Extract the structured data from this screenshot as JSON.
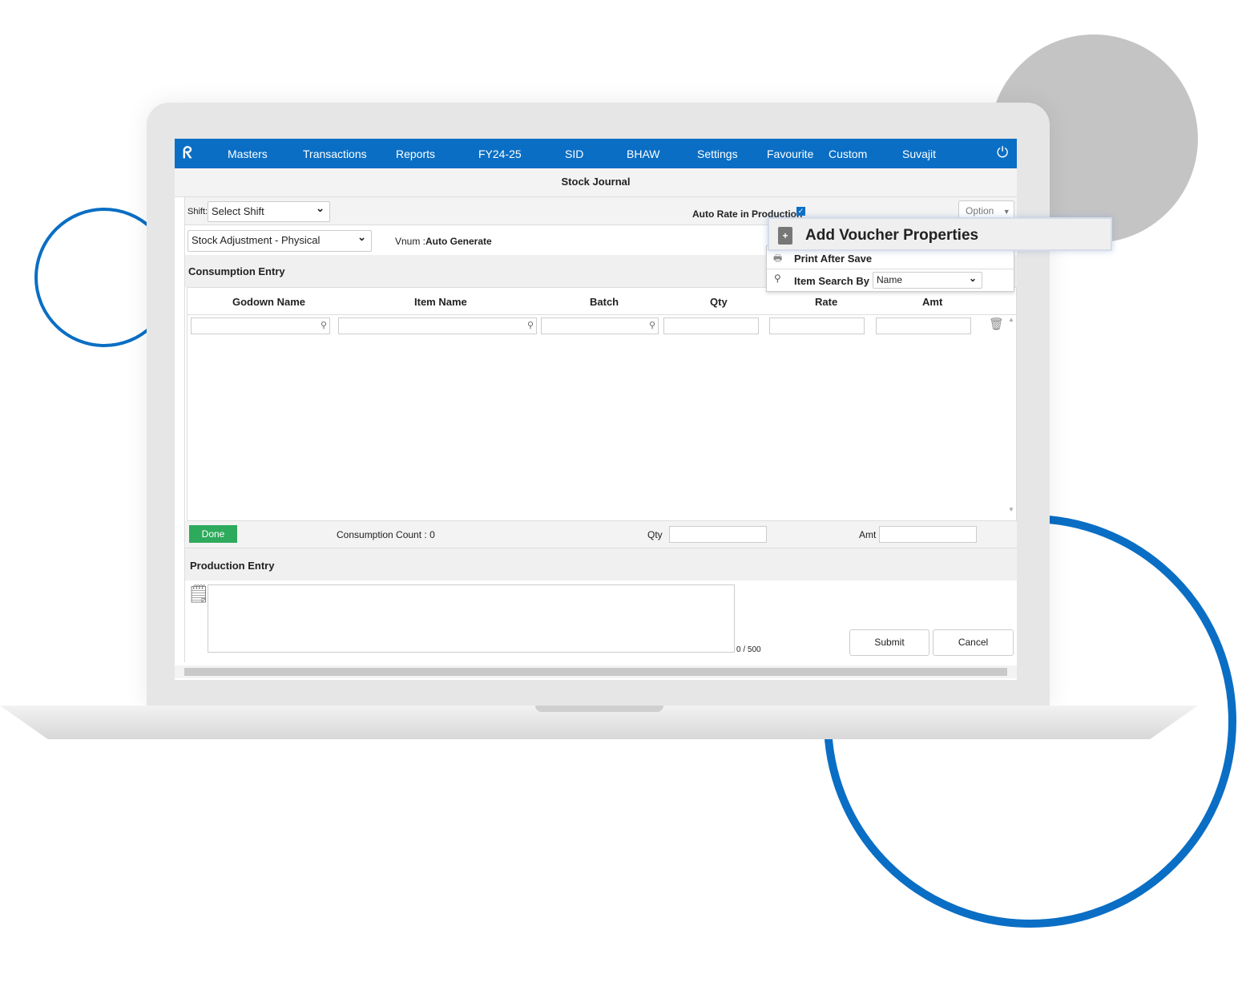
{
  "nav": {
    "items": [
      "Masters",
      "Transactions",
      "Reports",
      "FY24-25",
      "SID",
      "BHAW",
      "Settings",
      "Favourite",
      "Custom",
      "Suvajit"
    ]
  },
  "page_title": "Stock Journal",
  "shift": {
    "label": "Shift:",
    "value": "Select Shift"
  },
  "voucher_type": {
    "value": "Stock Adjustment - Physical"
  },
  "vnum": {
    "label": "Vnum :",
    "value": "Auto Generate"
  },
  "auto_rate": {
    "label": "Auto Rate in Production",
    "checked": true
  },
  "option": {
    "label": "Option"
  },
  "menu": {
    "add": "Add Voucher Properties",
    "print": "Print After Save",
    "search_label": "Item Search By :",
    "search_value": "Name"
  },
  "consumption": {
    "title": "Consumption Entry",
    "columns": [
      "Godown Name",
      "Item Name",
      "Batch",
      "Qty",
      "Rate",
      "Amt"
    ],
    "done": "Done",
    "count": "Consumption Count : 0",
    "qty_label": "Qty",
    "amt_label": "Amt"
  },
  "production": {
    "title": "Production Entry",
    "counter": "0 / 500",
    "submit": "Submit",
    "cancel": "Cancel"
  },
  "colors": {
    "brand": "#0a6ec4",
    "done": "#2eaa5c"
  }
}
